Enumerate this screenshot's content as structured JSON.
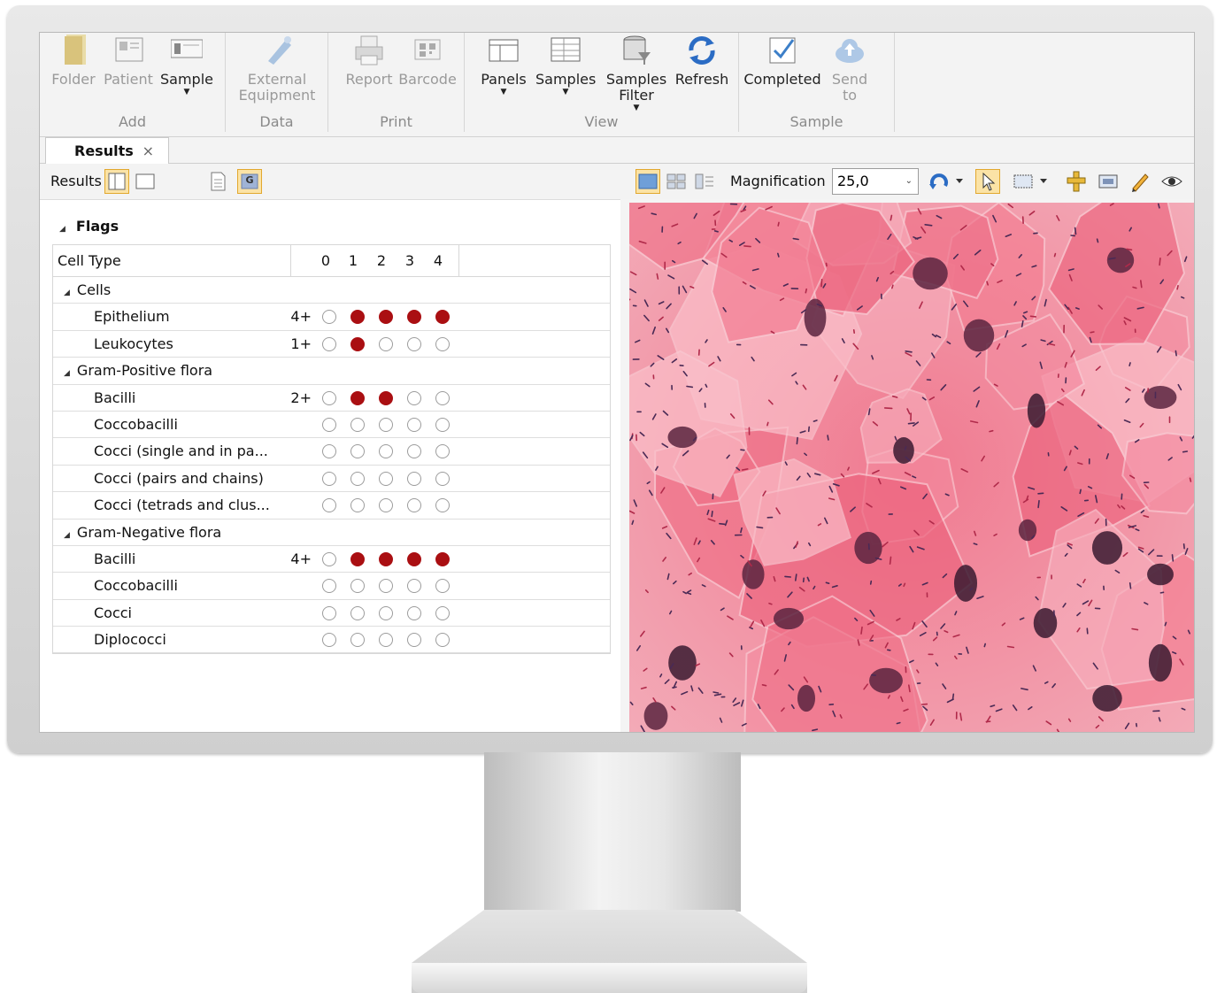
{
  "ribbon": {
    "groups": [
      {
        "label": "Add",
        "buttons": [
          {
            "label": "Folder",
            "icon": "folder-icon",
            "disabled": true
          },
          {
            "label": "Patient",
            "icon": "patient-card-icon",
            "disabled": true
          },
          {
            "label": "Sample",
            "icon": "sample-card-icon",
            "disabled": false,
            "dropdown": true
          }
        ]
      },
      {
        "label": "Data",
        "buttons": [
          {
            "label": "External Equipment",
            "icon": "external-equipment-icon",
            "disabled": true
          }
        ]
      },
      {
        "label": "Print",
        "buttons": [
          {
            "label": "Report",
            "icon": "printer-icon",
            "disabled": true
          },
          {
            "label": "Barcode",
            "icon": "barcode-icon",
            "disabled": true
          }
        ]
      },
      {
        "label": "View",
        "buttons": [
          {
            "label": "Panels",
            "icon": "panels-icon",
            "disabled": false,
            "dropdown": true
          },
          {
            "label": "Samples",
            "icon": "samples-icon",
            "disabled": false,
            "dropdown": true
          },
          {
            "label": "Samples Filter",
            "icon": "samples-filter-icon",
            "disabled": false,
            "dropdown": true
          },
          {
            "label": "Refresh",
            "icon": "refresh-icon",
            "disabled": false
          }
        ]
      },
      {
        "label": "Sample",
        "buttons": [
          {
            "label": "Completed",
            "icon": "completed-check-icon",
            "disabled": false
          },
          {
            "label": "Send to",
            "icon": "cloud-upload-icon",
            "disabled": true
          }
        ]
      }
    ]
  },
  "tabs": [
    {
      "label": "Results",
      "close": "×"
    }
  ],
  "toolbar": {
    "results_label": "Results",
    "magnification_label": "Magnification",
    "magnification_value": "25,0",
    "g_label": "G"
  },
  "flags": {
    "title": "Flags",
    "cell_type_header": "Cell Type",
    "levels": [
      "0",
      "1",
      "2",
      "3",
      "4"
    ],
    "groups": [
      {
        "label": "Cells",
        "rows": [
          {
            "name": "Epithelium",
            "grade": "4+",
            "selected": [
              1,
              2,
              3,
              4
            ]
          },
          {
            "name": "Leukocytes",
            "grade": "1+",
            "selected": [
              1
            ]
          }
        ]
      },
      {
        "label": "Gram-Positive flora",
        "rows": [
          {
            "name": "Bacilli",
            "grade": "2+",
            "selected": [
              1,
              2
            ]
          },
          {
            "name": "Coccobacilli",
            "grade": "",
            "selected": []
          },
          {
            "name": "Cocci (single and in pa...",
            "grade": "",
            "selected": []
          },
          {
            "name": "Cocci (pairs and chains)",
            "grade": "",
            "selected": []
          },
          {
            "name": "Cocci (tetrads and clus...",
            "grade": "",
            "selected": []
          }
        ]
      },
      {
        "label": "Gram-Negative flora",
        "rows": [
          {
            "name": "Bacilli",
            "grade": "4+",
            "selected": [
              1,
              2,
              3,
              4
            ]
          },
          {
            "name": "Coccobacilli",
            "grade": "",
            "selected": []
          },
          {
            "name": "Cocci",
            "grade": "",
            "selected": []
          },
          {
            "name": "Diplococci",
            "grade": "",
            "selected": []
          }
        ]
      }
    ]
  },
  "colors": {
    "selected_dot": "#aa0f12",
    "active_button": "#fbe3a6",
    "stain_pink": "#f06a82",
    "nucleus": "#3a1a30"
  }
}
